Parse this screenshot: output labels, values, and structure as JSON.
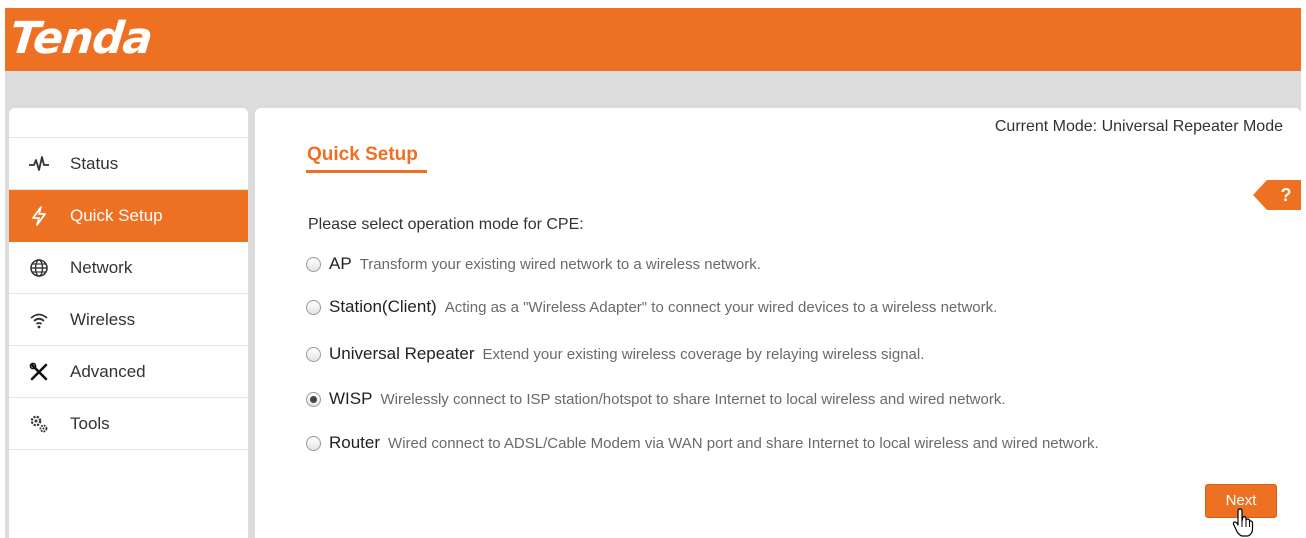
{
  "header": {
    "logo": "Tenda",
    "brand_color": "#ee7023"
  },
  "sidebar": {
    "items": [
      {
        "label": "Status",
        "icon": "pulse-icon",
        "active": false
      },
      {
        "label": "Quick Setup",
        "icon": "lightning-icon",
        "active": true
      },
      {
        "label": "Network",
        "icon": "globe-icon",
        "active": false
      },
      {
        "label": "Wireless",
        "icon": "wifi-icon",
        "active": false
      },
      {
        "label": "Advanced",
        "icon": "tools-cross-icon",
        "active": false
      },
      {
        "label": "Tools",
        "icon": "gears-icon",
        "active": false
      }
    ]
  },
  "main": {
    "current_mode": "Current Mode: Universal Repeater Mode",
    "title": "Quick Setup",
    "help": "?",
    "prompt": "Please select operation mode for CPE:",
    "options": [
      {
        "name": "AP",
        "desc": "Transform your existing wired network to a wireless network.",
        "checked": false
      },
      {
        "name": "Station(Client)",
        "desc": "Acting as a \"Wireless Adapter\" to connect your wired devices to a wireless network.",
        "checked": false
      },
      {
        "name": "Universal Repeater",
        "desc": "Extend your existing wireless coverage by relaying wireless signal.",
        "checked": false
      },
      {
        "name": "WISP",
        "desc": "Wirelessly connect to ISP station/hotspot to share Internet to local wireless and wired network.",
        "checked": true
      },
      {
        "name": "Router",
        "desc": "Wired connect to ADSL/Cable Modem via WAN port and share Internet to local wireless and wired network.",
        "checked": false
      }
    ],
    "next_label": "Next"
  }
}
